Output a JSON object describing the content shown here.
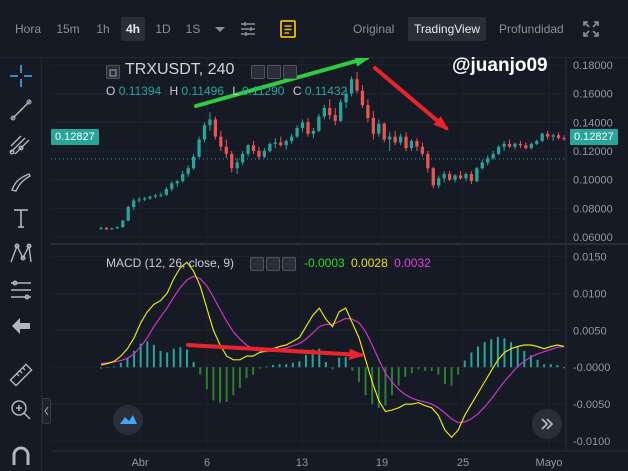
{
  "toolbar": {
    "time_label": "Hora",
    "intervals": [
      "15m",
      "1h",
      "4h",
      "1D",
      "1S"
    ],
    "active_interval": "4h",
    "views": [
      "Original",
      "TradingView",
      "Profundidad"
    ],
    "active_view": "TradingView"
  },
  "main_legend": {
    "symbol": "TRXUSDT, 240",
    "open_label": "O",
    "open_value": "0.11394",
    "high_label": "H",
    "high_value": "0.11496",
    "low_label": "L",
    "low_value": "0.11290",
    "close_label": "C",
    "close_value": "0.11432"
  },
  "watermark": "@juanjo09",
  "price_axis": {
    "ticks": [
      "0.18000",
      "0.16000",
      "0.14000",
      "0.12000",
      "0.10000",
      "0.08000",
      "0.06000"
    ],
    "left_tag": "0.12827",
    "right_tag": "0.12827"
  },
  "macd_legend": {
    "label": "MACD (12, 26, close, 9)",
    "histogram": "-0.0003",
    "macd": "0.0028",
    "signal": "0.0032"
  },
  "macd_axis": {
    "ticks": [
      "0.0150",
      "0.0100",
      "0.0050",
      "-0.0000",
      "-0.0050",
      "-0.0100"
    ]
  },
  "time_axis": {
    "ticks": [
      "Abr",
      "6",
      "13",
      "19",
      "25",
      "Mayo"
    ]
  },
  "colors": {
    "up": "#26a69a",
    "down": "#ef5350",
    "macd_line": "#e6e600",
    "signal_line": "#cc33cc",
    "histogram": "#4caf50",
    "annotation_green": "#2ecc40",
    "annotation_red": "#e8242c"
  },
  "chart_data": {
    "type": "candlestick",
    "title": "TRXUSDT, 240",
    "price_range": [
      0.058,
      0.182
    ],
    "candles": [
      [
        0.066,
        0.0672,
        0.0652,
        0.0665
      ],
      [
        0.0665,
        0.067,
        0.0648,
        0.0655
      ],
      [
        0.0655,
        0.0665,
        0.065,
        0.0662
      ],
      [
        0.0662,
        0.0675,
        0.0655,
        0.067
      ],
      [
        0.067,
        0.072,
        0.0665,
        0.0715
      ],
      [
        0.0715,
        0.082,
        0.071,
        0.081
      ],
      [
        0.081,
        0.087,
        0.079,
        0.0855
      ],
      [
        0.0855,
        0.088,
        0.084,
        0.0862
      ],
      [
        0.0862,
        0.088,
        0.085,
        0.087
      ],
      [
        0.087,
        0.089,
        0.086,
        0.0882
      ],
      [
        0.0882,
        0.09,
        0.087,
        0.089
      ],
      [
        0.089,
        0.091,
        0.088,
        0.0895
      ],
      [
        0.0895,
        0.095,
        0.0885,
        0.0935
      ],
      [
        0.0935,
        0.099,
        0.092,
        0.0975
      ],
      [
        0.0975,
        0.1,
        0.095,
        0.099
      ],
      [
        0.099,
        0.106,
        0.098,
        0.104
      ],
      [
        0.104,
        0.11,
        0.102,
        0.108
      ],
      [
        0.108,
        0.118,
        0.107,
        0.116
      ],
      [
        0.116,
        0.13,
        0.115,
        0.128
      ],
      [
        0.128,
        0.14,
        0.126,
        0.138
      ],
      [
        0.138,
        0.147,
        0.134,
        0.142
      ],
      [
        0.142,
        0.144,
        0.128,
        0.13
      ],
      [
        0.13,
        0.134,
        0.12,
        0.123
      ],
      [
        0.123,
        0.128,
        0.115,
        0.118
      ],
      [
        0.118,
        0.12,
        0.105,
        0.108
      ],
      [
        0.108,
        0.115,
        0.104,
        0.112
      ],
      [
        0.112,
        0.12,
        0.11,
        0.118
      ],
      [
        0.118,
        0.125,
        0.116,
        0.124
      ],
      [
        0.124,
        0.127,
        0.118,
        0.12
      ],
      [
        0.12,
        0.123,
        0.114,
        0.116
      ],
      [
        0.116,
        0.122,
        0.115,
        0.12
      ],
      [
        0.12,
        0.126,
        0.119,
        0.125
      ],
      [
        0.125,
        0.129,
        0.122,
        0.126
      ],
      [
        0.126,
        0.13,
        0.123,
        0.124
      ],
      [
        0.124,
        0.128,
        0.121,
        0.127
      ],
      [
        0.127,
        0.132,
        0.125,
        0.13
      ],
      [
        0.13,
        0.138,
        0.129,
        0.136
      ],
      [
        0.136,
        0.142,
        0.133,
        0.14
      ],
      [
        0.14,
        0.143,
        0.13,
        0.132
      ],
      [
        0.132,
        0.136,
        0.129,
        0.134
      ],
      [
        0.134,
        0.146,
        0.133,
        0.144
      ],
      [
        0.144,
        0.152,
        0.142,
        0.15
      ],
      [
        0.15,
        0.156,
        0.142,
        0.145
      ],
      [
        0.145,
        0.15,
        0.138,
        0.141
      ],
      [
        0.141,
        0.156,
        0.14,
        0.154
      ],
      [
        0.154,
        0.164,
        0.15,
        0.16
      ],
      [
        0.16,
        0.172,
        0.158,
        0.17
      ],
      [
        0.17,
        0.175,
        0.16,
        0.162
      ],
      [
        0.162,
        0.166,
        0.15,
        0.152
      ],
      [
        0.152,
        0.156,
        0.14,
        0.143
      ],
      [
        0.143,
        0.148,
        0.128,
        0.132
      ],
      [
        0.132,
        0.142,
        0.13,
        0.139
      ],
      [
        0.139,
        0.14,
        0.126,
        0.128
      ],
      [
        0.128,
        0.133,
        0.12,
        0.13
      ],
      [
        0.13,
        0.134,
        0.124,
        0.126
      ],
      [
        0.126,
        0.132,
        0.124,
        0.13
      ],
      [
        0.13,
        0.133,
        0.12,
        0.122
      ],
      [
        0.122,
        0.128,
        0.12,
        0.127
      ],
      [
        0.127,
        0.129,
        0.12,
        0.123
      ],
      [
        0.123,
        0.126,
        0.116,
        0.118
      ],
      [
        0.118,
        0.12,
        0.105,
        0.108
      ],
      [
        0.108,
        0.109,
        0.094,
        0.096
      ],
      [
        0.096,
        0.103,
        0.094,
        0.101
      ],
      [
        0.101,
        0.106,
        0.098,
        0.104
      ],
      [
        0.104,
        0.106,
        0.099,
        0.1
      ],
      [
        0.1,
        0.104,
        0.098,
        0.103
      ],
      [
        0.103,
        0.106,
        0.1,
        0.101
      ],
      [
        0.101,
        0.105,
        0.099,
        0.104
      ],
      [
        0.104,
        0.106,
        0.097,
        0.099
      ],
      [
        0.099,
        0.109,
        0.098,
        0.108
      ],
      [
        0.108,
        0.114,
        0.107,
        0.112
      ],
      [
        0.112,
        0.117,
        0.11,
        0.115
      ],
      [
        0.115,
        0.12,
        0.114,
        0.118
      ],
      [
        0.118,
        0.124,
        0.117,
        0.123
      ],
      [
        0.123,
        0.127,
        0.12,
        0.125
      ],
      [
        0.125,
        0.128,
        0.122,
        0.123
      ],
      [
        0.123,
        0.126,
        0.121,
        0.125
      ],
      [
        0.125,
        0.127,
        0.122,
        0.124
      ],
      [
        0.124,
        0.126,
        0.121,
        0.122
      ],
      [
        0.122,
        0.126,
        0.121,
        0.125
      ],
      [
        0.125,
        0.128,
        0.124,
        0.127
      ],
      [
        0.127,
        0.133,
        0.126,
        0.132
      ],
      [
        0.132,
        0.134,
        0.128,
        0.13
      ],
      [
        0.13,
        0.132,
        0.127,
        0.131
      ],
      [
        0.131,
        0.133,
        0.128,
        0.129
      ],
      [
        0.129,
        0.131,
        0.127,
        0.1283
      ]
    ],
    "dotted_level": 0.1145,
    "macd_range": [
      -0.0108,
      0.016
    ],
    "macd": [
      0.0003,
      0.0005,
      0.0008,
      0.0015,
      0.0025,
      0.004,
      0.006,
      0.0075,
      0.0085,
      0.009,
      0.01,
      0.012,
      0.0135,
      0.0142,
      0.013,
      0.011,
      0.008,
      0.005,
      0.003,
      0.0015,
      0.001,
      0.001,
      0.0015,
      0.0015,
      0.002,
      0.0022,
      0.0025,
      0.0028,
      0.003,
      0.0035,
      0.004,
      0.0055,
      0.007,
      0.008,
      0.0065,
      0.0055,
      0.0075,
      0.008,
      0.006,
      0.004,
      0.001,
      -0.002,
      -0.0045,
      -0.006,
      -0.0058,
      -0.0055,
      -0.005,
      -0.005,
      -0.0048,
      -0.0052,
      -0.0055,
      -0.0065,
      -0.0085,
      -0.0095,
      -0.0085,
      -0.0065,
      -0.005,
      -0.0035,
      -0.002,
      -0.0005,
      0.001,
      0.002,
      0.0025,
      0.0028,
      0.003,
      0.003,
      0.0028,
      0.0025,
      0.0028,
      0.003,
      0.0028
    ],
    "signal": [
      0.0005,
      0.0006,
      0.0007,
      0.0009,
      0.0012,
      0.0018,
      0.0028,
      0.004,
      0.0055,
      0.0068,
      0.008,
      0.0095,
      0.0108,
      0.0118,
      0.0123,
      0.012,
      0.011,
      0.0095,
      0.0078,
      0.0062,
      0.0048,
      0.0038,
      0.003,
      0.0025,
      0.0022,
      0.0021,
      0.0022,
      0.0024,
      0.0026,
      0.0029,
      0.0032,
      0.0038,
      0.0046,
      0.0055,
      0.0058,
      0.0058,
      0.0062,
      0.0066,
      0.0065,
      0.006,
      0.0048,
      0.003,
      0.001,
      -0.0008,
      -0.002,
      -0.003,
      -0.0037,
      -0.0042,
      -0.0045,
      -0.0047,
      -0.005,
      -0.0055,
      -0.0062,
      -0.007,
      -0.0075,
      -0.0074,
      -0.007,
      -0.0063,
      -0.0054,
      -0.0043,
      -0.0031,
      -0.0019,
      -0.0009,
      0.0001,
      0.0008,
      0.0014,
      0.0018,
      0.0021,
      0.0024,
      0.0027,
      0.0028
    ]
  }
}
